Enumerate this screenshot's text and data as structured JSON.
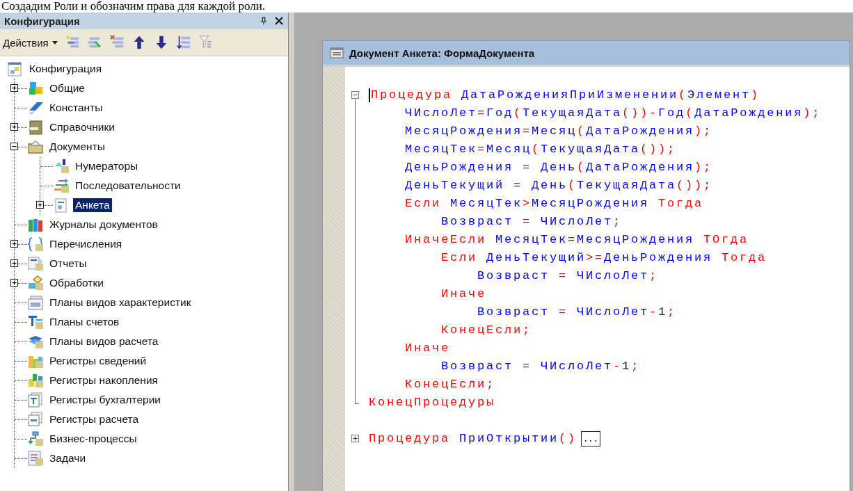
{
  "page_text": "Создадим Роли и обозначим права для каждой роли.",
  "config_panel": {
    "title": "Конфигурация",
    "toolbar": {
      "actions_label": "Действия"
    },
    "tree": {
      "label": "Конфигурация",
      "selected": false,
      "children": [
        {
          "label": "Общие",
          "expanded": false,
          "selected": false
        },
        {
          "label": "Константы",
          "selected": false
        },
        {
          "label": "Справочники",
          "expanded": false,
          "selected": false
        },
        {
          "label": "Документы",
          "expanded": true,
          "selected": false,
          "children": [
            {
              "label": "Нумераторы",
              "selected": false
            },
            {
              "label": "Последовательности",
              "selected": false
            },
            {
              "label": "Анкета",
              "expanded": false,
              "selected": true
            }
          ]
        },
        {
          "label": "Журналы документов",
          "selected": false
        },
        {
          "label": "Перечисления",
          "expanded": false,
          "selected": false
        },
        {
          "label": "Отчеты",
          "expanded": false,
          "selected": false
        },
        {
          "label": "Обработки",
          "expanded": false,
          "selected": false
        },
        {
          "label": "Планы видов характеристик",
          "selected": false
        },
        {
          "label": "Планы счетов",
          "selected": false
        },
        {
          "label": "Планы видов расчета",
          "selected": false
        },
        {
          "label": "Регистры сведений",
          "selected": false
        },
        {
          "label": "Регистры накопления",
          "selected": false
        },
        {
          "label": "Регистры бухгалтерии",
          "selected": false
        },
        {
          "label": "Регистры расчета",
          "selected": false
        },
        {
          "label": "Бизнес-процессы",
          "selected": false
        },
        {
          "label": "Задачи",
          "selected": false
        }
      ]
    }
  },
  "editor": {
    "title": "Документ Анкета: ФормаДокумента",
    "lines": [
      {
        "kind": "fold_start",
        "caret": true,
        "tokens": [
          {
            "kind": "keyword",
            "text": "Процедура "
          },
          {
            "kind": "ident",
            "text": "ДатаРожденияПриИзменении"
          },
          {
            "kind": "punct",
            "text": "("
          },
          {
            "kind": "ident",
            "text": "Элемент"
          },
          {
            "kind": "punct",
            "text": ")"
          }
        ],
        "children": [
          {
            "tokens": [
              {
                "kind": "ident",
                "text": "ЧИслоЛет"
              },
              {
                "kind": "punct",
                "text": "="
              },
              {
                "kind": "ident",
                "text": "Год"
              },
              {
                "kind": "punct",
                "text": "("
              },
              {
                "kind": "ident",
                "text": "ТекущаяДата"
              },
              {
                "kind": "punct",
                "text": "())-"
              },
              {
                "kind": "ident",
                "text": "Год"
              },
              {
                "kind": "punct",
                "text": "("
              },
              {
                "kind": "ident",
                "text": "ДатаРождения"
              },
              {
                "kind": "punct",
                "text": ");"
              }
            ]
          },
          {
            "tokens": [
              {
                "kind": "ident",
                "text": "МесяцРождения"
              },
              {
                "kind": "punct",
                "text": "="
              },
              {
                "kind": "ident",
                "text": "Месяц"
              },
              {
                "kind": "punct",
                "text": "("
              },
              {
                "kind": "ident",
                "text": "ДатаРождения"
              },
              {
                "kind": "punct",
                "text": ");"
              }
            ]
          },
          {
            "tokens": [
              {
                "kind": "ident",
                "text": "МесяцТек"
              },
              {
                "kind": "punct",
                "text": "="
              },
              {
                "kind": "ident",
                "text": "Месяц"
              },
              {
                "kind": "punct",
                "text": "("
              },
              {
                "kind": "ident",
                "text": "ТекущаяДата"
              },
              {
                "kind": "punct",
                "text": "());"
              }
            ]
          },
          {
            "tokens": [
              {
                "kind": "ident",
                "text": "ДеньРождения "
              },
              {
                "kind": "punct",
                "text": "="
              },
              {
                "kind": "ident",
                "text": " День"
              },
              {
                "kind": "punct",
                "text": "("
              },
              {
                "kind": "ident",
                "text": "ДатаРождения"
              },
              {
                "kind": "punct",
                "text": ");"
              }
            ]
          },
          {
            "tokens": [
              {
                "kind": "ident",
                "text": "ДеньТекущий "
              },
              {
                "kind": "punct",
                "text": "="
              },
              {
                "kind": "ident",
                "text": " День"
              },
              {
                "kind": "punct",
                "text": "("
              },
              {
                "kind": "ident",
                "text": "ТекущаяДата"
              },
              {
                "kind": "punct",
                "text": "());"
              }
            ]
          },
          {
            "tokens": [
              {
                "kind": "keyword",
                "text": "Если "
              },
              {
                "kind": "ident",
                "text": "МесяцТек"
              },
              {
                "kind": "punct",
                "text": ">"
              },
              {
                "kind": "ident",
                "text": "МесяцРождения "
              },
              {
                "kind": "keyword",
                "text": "Тогда"
              }
            ],
            "children": [
              {
                "tokens": [
                  {
                    "kind": "ident",
                    "text": "Возвраст "
                  },
                  {
                    "kind": "punct",
                    "text": "="
                  },
                  {
                    "kind": "ident",
                    "text": " ЧИслоЛет"
                  },
                  {
                    "kind": "punct",
                    "text": ";"
                  }
                ]
              }
            ]
          },
          {
            "tokens": [
              {
                "kind": "keyword",
                "text": "ИначеЕсли "
              },
              {
                "kind": "ident",
                "text": "МесяцТек"
              },
              {
                "kind": "punct",
                "text": "="
              },
              {
                "kind": "ident",
                "text": "МесяцРождения "
              },
              {
                "kind": "keyword",
                "text": "ТОгда"
              }
            ],
            "children": [
              {
                "tokens": [
                  {
                    "kind": "keyword",
                    "text": "Если "
                  },
                  {
                    "kind": "ident",
                    "text": "ДеньТекущий"
                  },
                  {
                    "kind": "punct",
                    "text": ">="
                  },
                  {
                    "kind": "ident",
                    "text": "ДеньРождения "
                  },
                  {
                    "kind": "keyword",
                    "text": "Тогда"
                  }
                ],
                "children": [
                  {
                    "tokens": [
                      {
                        "kind": "ident",
                        "text": "Возвраст "
                      },
                      {
                        "kind": "punct",
                        "text": "="
                      },
                      {
                        "kind": "ident",
                        "text": " ЧИслоЛет"
                      },
                      {
                        "kind": "punct",
                        "text": ";"
                      }
                    ]
                  }
                ]
              },
              {
                "tokens": [
                  {
                    "kind": "keyword",
                    "text": "Иначе"
                  }
                ],
                "children": [
                  {
                    "tokens": [
                      {
                        "kind": "ident",
                        "text": "Возвраст "
                      },
                      {
                        "kind": "punct",
                        "text": "="
                      },
                      {
                        "kind": "ident",
                        "text": " ЧИслоЛет"
                      },
                      {
                        "kind": "punct",
                        "text": "-"
                      },
                      {
                        "kind": "number",
                        "text": "1"
                      },
                      {
                        "kind": "punct",
                        "text": ";"
                      }
                    ]
                  }
                ]
              },
              {
                "tokens": [
                  {
                    "kind": "keyword",
                    "text": "КонецЕсли;"
                  }
                ]
              }
            ]
          },
          {
            "tokens": [
              {
                "kind": "keyword",
                "text": "Иначе"
              }
            ],
            "children": [
              {
                "tokens": [
                  {
                    "kind": "ident",
                    "text": "Возвраст "
                  },
                  {
                    "kind": "punct",
                    "text": "="
                  },
                  {
                    "kind": "ident",
                    "text": " ЧИслоЛет"
                  },
                  {
                    "kind": "punct",
                    "text": "-"
                  },
                  {
                    "kind": "number",
                    "text": "1"
                  },
                  {
                    "kind": "punct",
                    "text": ";"
                  }
                ]
              }
            ]
          },
          {
            "tokens": [
              {
                "kind": "keyword",
                "text": "КонецЕсли;"
              }
            ]
          }
        ]
      },
      {
        "kind": "fold_end",
        "tokens": [
          {
            "kind": "keyword",
            "text": "КонецПроцедуры"
          }
        ]
      },
      {
        "kind": "blank"
      },
      {
        "kind": "fold_collapsed",
        "folded_text": "...",
        "tokens": [
          {
            "kind": "keyword",
            "text": "Процедура "
          },
          {
            "kind": "ident",
            "text": "ПриОткрытии"
          },
          {
            "kind": "punct",
            "text": "()"
          }
        ]
      }
    ]
  }
}
